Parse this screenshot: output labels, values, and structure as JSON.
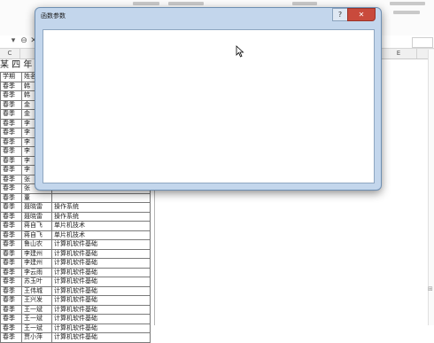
{
  "sheet": {
    "title": "某 四 年 20",
    "column_headers": [
      "C",
      "E"
    ],
    "rows": [
      [
        "学期",
        "姓名",
        ""
      ],
      [
        "春季",
        "韩",
        ""
      ],
      [
        "春季",
        "韩",
        ""
      ],
      [
        "春季",
        "金",
        ""
      ],
      [
        "春季",
        "金",
        ""
      ],
      [
        "春季",
        "李",
        ""
      ],
      [
        "春季",
        "李",
        ""
      ],
      [
        "春季",
        "李",
        ""
      ],
      [
        "春季",
        "李",
        ""
      ],
      [
        "春季",
        "李",
        ""
      ],
      [
        "春季",
        "李",
        ""
      ],
      [
        "春季",
        "张",
        ""
      ],
      [
        "春季",
        "张",
        ""
      ],
      [
        "春季",
        "董",
        ""
      ],
      [
        "春季",
        "聂晓雷",
        "操作系统"
      ],
      [
        "春季",
        "聂晓雷",
        "操作系统"
      ],
      [
        "春季",
        "蒋自飞",
        "单片机技术"
      ],
      [
        "春季",
        "蒋自飞",
        "单片机技术"
      ],
      [
        "春季",
        "鲁山农",
        "计算机软件基础"
      ],
      [
        "春季",
        "李建州",
        "计算机软件基础"
      ],
      [
        "春季",
        "李建州",
        "计算机软件基础"
      ],
      [
        "春季",
        "李云雨",
        "计算机软件基础"
      ],
      [
        "春季",
        "苏玉叶",
        "计算机软件基础"
      ],
      [
        "春季",
        "王伟城",
        "计算机软件基础"
      ],
      [
        "春季",
        "王兴发",
        "计算机软件基础"
      ],
      [
        "春季",
        "王一斌",
        "计算机软件基础"
      ],
      [
        "春季",
        "王一斌",
        "计算机软件基础"
      ],
      [
        "春季",
        "王一斌",
        "计算机软件基础"
      ],
      [
        "春季",
        "贾小萍",
        "计算机软件基础"
      ]
    ]
  },
  "dialog": {
    "title": "函数参数",
    "help_label": "?",
    "close_label": "✕"
  },
  "icons": {
    "cursor": "mouse-pointer-icon",
    "cancel": "cancel-x-icon",
    "confirm": "check-icon",
    "function": "fx-icon"
  }
}
